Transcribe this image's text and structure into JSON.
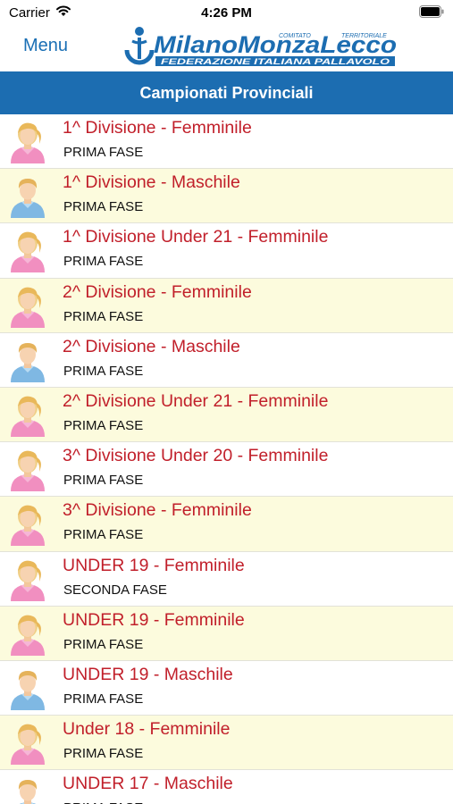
{
  "status_bar": {
    "carrier": "Carrier",
    "time": "4:26 PM"
  },
  "navbar": {
    "menu_label": "Menu",
    "logo": {
      "line1": "MilanoMonzaLecco",
      "comitato": "COMITATO",
      "territoriale": "TERRITORIALE",
      "line2": "FEDERAZIONE ITALIANA PALLAVOLO"
    }
  },
  "header": {
    "title": "Campionati Provinciali"
  },
  "colors": {
    "accent": "#1c6db1",
    "title_red": "#c11f2a",
    "row_alt": "#fcfbdd"
  },
  "rows": [
    {
      "title": "1^ Divisione - Femminile",
      "phase": "PRIMA FASE",
      "gender": "female",
      "icon": "female-user-icon"
    },
    {
      "title": "1^ Divisione - Maschile",
      "phase": "PRIMA FASE",
      "gender": "male",
      "icon": "male-user-icon"
    },
    {
      "title": "1^ Divisione Under 21 - Femminile",
      "phase": "PRIMA FASE",
      "gender": "female",
      "icon": "female-user-icon"
    },
    {
      "title": "2^ Divisione - Femminile",
      "phase": "PRIMA FASE",
      "gender": "female",
      "icon": "female-user-icon"
    },
    {
      "title": "2^ Divisione - Maschile",
      "phase": "PRIMA FASE",
      "gender": "male",
      "icon": "male-user-icon"
    },
    {
      "title": "2^ Divisione Under 21 - Femminile",
      "phase": "PRIMA FASE",
      "gender": "female",
      "icon": "female-user-icon"
    },
    {
      "title": "3^ Divisione Under 20 - Femminile",
      "phase": "PRIMA FASE",
      "gender": "female",
      "icon": "female-user-icon"
    },
    {
      "title": "3^ Divisione - Femminile",
      "phase": "PRIMA FASE",
      "gender": "female",
      "icon": "female-user-icon"
    },
    {
      "title": "UNDER 19 - Femminile",
      "phase": "SECONDA FASE",
      "gender": "female",
      "icon": "female-user-icon"
    },
    {
      "title": "UNDER 19 - Femminile",
      "phase": "PRIMA FASE",
      "gender": "female",
      "icon": "female-user-icon"
    },
    {
      "title": "UNDER 19 - Maschile",
      "phase": "PRIMA FASE",
      "gender": "male",
      "icon": "male-user-icon"
    },
    {
      "title": "Under 18 - Femminile",
      "phase": "PRIMA FASE",
      "gender": "female",
      "icon": "female-user-icon"
    },
    {
      "title": "UNDER 17 - Maschile",
      "phase": "PRIMA FASE",
      "gender": "male",
      "icon": "male-user-icon"
    }
  ]
}
